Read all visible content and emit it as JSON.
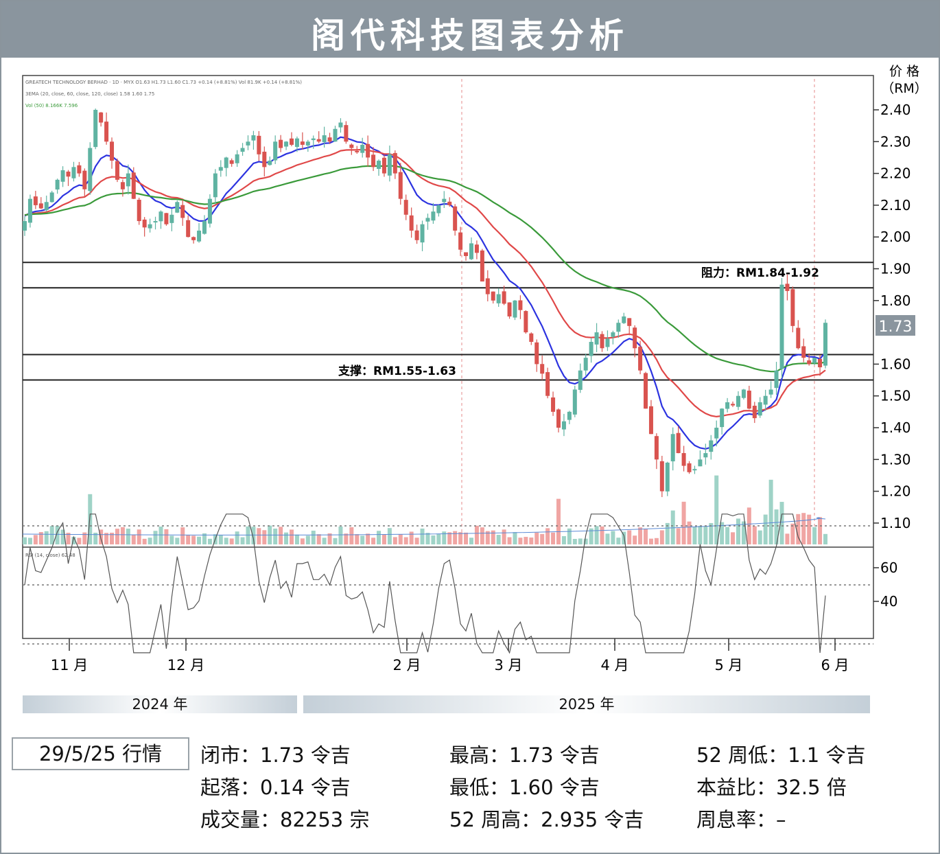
{
  "title": "阁代科技图表分析",
  "price_axis_title": [
    "价 格",
    "（RM）"
  ],
  "legend_lines": [
    "GREATECH TECHNOLOGY BERHAD · 1D · MYX  O1.63 H1.73 L1.60 C1.73 +0.14 (+8.81%)  Vol 81.9K  +0.14 (+8.81%)",
    "3EMA (20, close, 60, close, 120, close)  1.58  1.60  1.75",
    "Vol (50)  8.166K  7.596"
  ],
  "resistance_label": "阻力：RM1.84-1.92",
  "support_label": "支撑：RM1.55-1.63",
  "current_price_tag": "1.73",
  "rsi_label": "RSI (14, close)  62.48",
  "x_month_labels": [
    "11 月",
    "12 月",
    "2 月",
    "3 月",
    "4 月",
    "5 月",
    "6 月"
  ],
  "year_labels": [
    "2024 年",
    "2025 年"
  ],
  "info": {
    "date": "29/5/25 行情",
    "close": "闭市：1.73 令吉",
    "change": "起落：0.14 令吉",
    "volume": "成交量：82253 宗",
    "high": "最高：1.73 令吉",
    "low": "最低：1.60 令吉",
    "high52": "52 周高：2.935 令吉",
    "low52": "52 周低：1.1 令吉",
    "pe": "本益比：32.5 倍",
    "yield": "周息率：–"
  },
  "colors": {
    "up": "#5fb3a2",
    "down": "#d9534f",
    "ema_fast": "#2c33e0",
    "ema_mid": "#e04848",
    "ema_slow": "#3a9a3a",
    "banner": "#8a959e",
    "price_tag": "#8a959e",
    "zone_line": "#222222"
  },
  "chart_data": {
    "type": "candlestick",
    "title": "阁代科技图表分析",
    "xlabel": "",
    "ylabel": "价格（RM）",
    "y_ticks": [
      "2.40",
      "2.30",
      "2.20",
      "2.10",
      "2.00",
      "1.90",
      "1.80",
      "1.60",
      "1.50",
      "1.40",
      "1.30",
      "1.20",
      "1.10"
    ],
    "ylim": [
      1.05,
      2.45
    ],
    "x_ticks": [
      "11 月",
      "12 月",
      "2 月",
      "3 月",
      "4 月",
      "5 月",
      "6 月"
    ],
    "resistance_zone": [
      1.84,
      1.92
    ],
    "support_zone": [
      1.55,
      1.63
    ],
    "last_close": 1.73,
    "close_series": [
      2.05,
      2.12,
      2.1,
      2.09,
      2.11,
      2.14,
      2.18,
      2.21,
      2.19,
      2.22,
      2.2,
      2.15,
      2.28,
      2.4,
      2.36,
      2.3,
      2.24,
      2.18,
      2.15,
      2.2,
      2.12,
      2.05,
      2.03,
      2.04,
      2.05,
      2.08,
      2.04,
      2.07,
      2.11,
      2.06,
      2.0,
      1.99,
      2.02,
      2.05,
      2.12,
      2.2,
      2.22,
      2.25,
      2.23,
      2.26,
      2.28,
      2.3,
      2.32,
      2.26,
      2.22,
      2.24,
      2.3,
      2.28,
      2.3,
      2.29,
      2.31,
      2.29,
      2.3,
      2.31,
      2.3,
      2.32,
      2.3,
      2.34,
      2.36,
      2.3,
      2.28,
      2.27,
      2.29,
      2.25,
      2.22,
      2.24,
      2.2,
      2.26,
      2.2,
      2.12,
      2.07,
      2.02,
      1.99,
      2.04,
      2.06,
      2.08,
      2.1,
      2.12,
      2.1,
      2.02,
      1.96,
      1.94,
      1.98,
      1.95,
      1.86,
      1.82,
      1.8,
      1.82,
      1.79,
      1.75,
      1.8,
      1.77,
      1.7,
      1.67,
      1.6,
      1.57,
      1.5,
      1.45,
      1.4,
      1.42,
      1.45,
      1.52,
      1.58,
      1.62,
      1.67,
      1.7,
      1.65,
      1.68,
      1.7,
      1.73,
      1.75,
      1.72,
      1.65,
      1.58,
      1.46,
      1.38,
      1.3,
      1.2,
      1.29,
      1.38,
      1.32,
      1.28,
      1.26,
      1.27,
      1.3,
      1.32,
      1.36,
      1.4,
      1.46,
      1.48,
      1.47,
      1.5,
      1.52,
      1.46,
      1.43,
      1.48,
      1.5,
      1.52,
      1.58,
      1.85,
      1.83,
      1.72,
      1.65,
      1.62,
      1.6,
      1.62,
      1.59,
      1.73
    ],
    "ema": [
      {
        "name": "EMA 20",
        "last": 1.58
      },
      {
        "name": "EMA 60",
        "last": 1.6
      },
      {
        "name": "EMA 120",
        "last": 1.75
      }
    ],
    "volume": {
      "name": "Vol (50)",
      "values_k": [
        8.166,
        7.596
      ]
    },
    "rsi": {
      "name": "RSI (14, close)",
      "last": 62.48,
      "ticks": [
        "60",
        "40"
      ],
      "levels": [
        70,
        50,
        30
      ]
    }
  }
}
